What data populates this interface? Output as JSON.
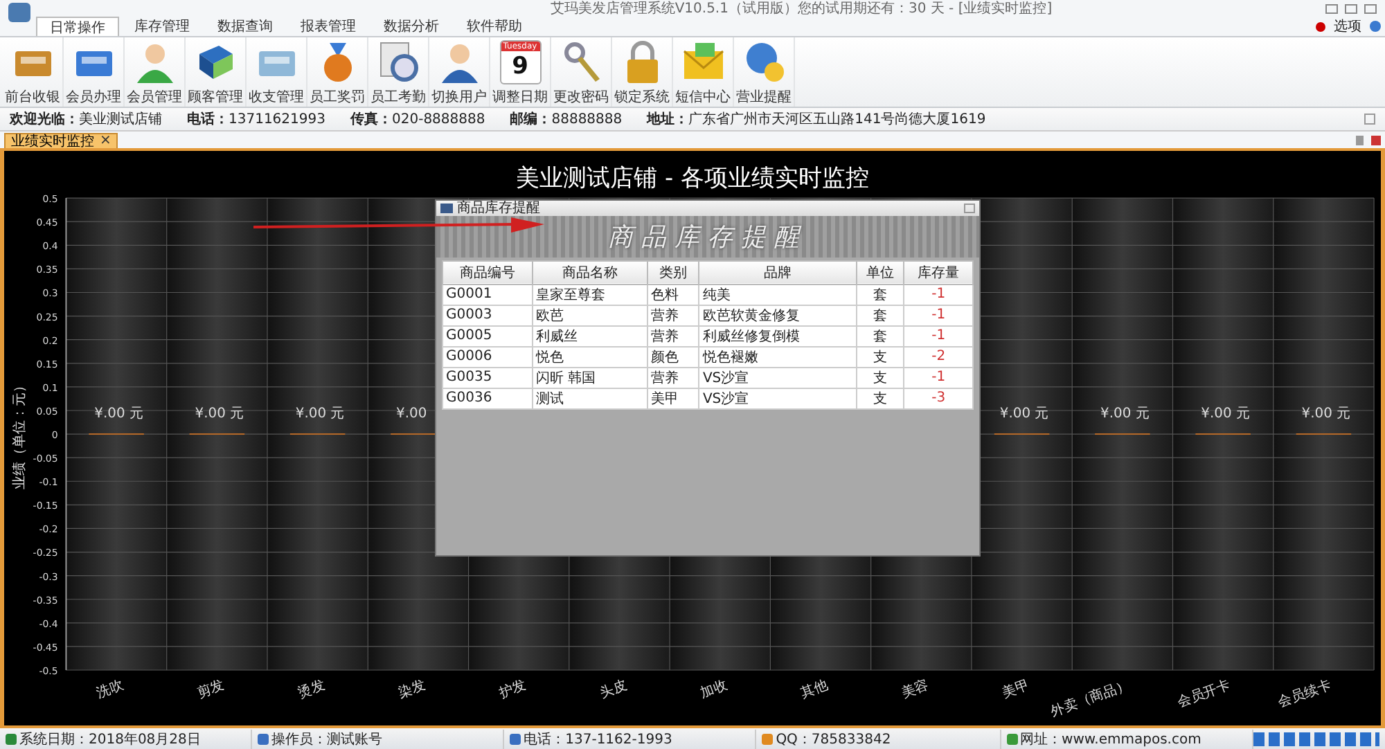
{
  "window": {
    "title": "艾玛美发店管理系统V10.5.1（试用版）您的试用期还有：30 天 - [业绩实时监控]",
    "options": "选项"
  },
  "menu": [
    {
      "label": "日常操作",
      "selected": true
    },
    {
      "label": "库存管理",
      "selected": false
    },
    {
      "label": "数据查询",
      "selected": false
    },
    {
      "label": "报表管理",
      "selected": false
    },
    {
      "label": "数据分析",
      "selected": false
    },
    {
      "label": "软件帮助",
      "selected": false
    }
  ],
  "toolbar": [
    {
      "label": "前台收银"
    },
    {
      "label": "会员办理"
    },
    {
      "label": "会员管理"
    },
    {
      "label": "顾客管理"
    },
    {
      "label": "收支管理"
    },
    {
      "label": "员工奖罚"
    },
    {
      "label": "员工考勤"
    },
    {
      "label": "切换用户"
    },
    {
      "label": "调整日期",
      "day": "Tuesday",
      "date": "9"
    },
    {
      "label": "更改密码"
    },
    {
      "label": "锁定系统"
    },
    {
      "label": "短信中心"
    },
    {
      "label": "营业提醒"
    }
  ],
  "info_bar": [
    {
      "label": "欢迎光临：",
      "value": "美业测试店铺"
    },
    {
      "label": "电话：",
      "value": "13711621993"
    },
    {
      "label": "传真：",
      "value": "020-8888888"
    },
    {
      "label": "邮编：",
      "value": "88888888"
    },
    {
      "label": "地址：",
      "value": "广东省广州市天河区五山路141号尚德大厦1619"
    }
  ],
  "doc_tab": {
    "label": "业绩实时监控",
    "close": "×"
  },
  "chart_data": {
    "type": "bar",
    "title": "美业测试店铺 - 各项业绩实时监控",
    "ylabel": "业绩（单位：元）",
    "categories": [
      "洗吹",
      "剪发",
      "烫发",
      "染发",
      "护发",
      "头皮",
      "加收",
      "其他",
      "美容",
      "美甲",
      "外卖（商品）",
      "会员开卡",
      "会员续卡"
    ],
    "values": [
      0,
      0,
      0,
      0,
      0,
      0,
      0,
      0,
      0,
      0,
      0,
      0,
      0
    ],
    "ylim": [
      -0.5,
      0.5
    ],
    "yticks": [
      {
        "value": -0.5,
        "label": "-0.5"
      },
      {
        "value": -0.45,
        "label": "-0.45"
      },
      {
        "value": -0.4,
        "label": "-0.4"
      },
      {
        "value": -0.35,
        "label": "-0.35"
      },
      {
        "value": -0.3,
        "label": "-0.3"
      },
      {
        "value": -0.25,
        "label": "-0.25"
      },
      {
        "value": -0.2,
        "label": "-0.2"
      },
      {
        "value": -0.15,
        "label": "-0.15"
      },
      {
        "value": -0.1,
        "label": "-0.1"
      },
      {
        "value": -0.05,
        "label": "-0.05"
      },
      {
        "value": 0,
        "label": "0"
      },
      {
        "value": 0.05,
        "label": "0.05"
      },
      {
        "value": 0.1,
        "label": "0.1"
      },
      {
        "value": 0.15,
        "label": "0.15"
      },
      {
        "value": 0.2,
        "label": "0.2"
      },
      {
        "value": 0.25,
        "label": "0.25"
      },
      {
        "value": 0.3,
        "label": "0.3"
      },
      {
        "value": 0.35,
        "label": "0.35"
      },
      {
        "value": 0.4,
        "label": "0.4"
      },
      {
        "value": 0.45,
        "label": "0.45"
      },
      {
        "value": 0.5,
        "label": "0.5"
      }
    ],
    "grid": true,
    "value_labels": [
      "¥.00 元",
      "¥.00 元",
      "¥.00 元",
      "¥.00",
      null,
      null,
      null,
      null,
      null,
      "¥.00 元",
      "¥.00 元",
      "¥.00 元",
      "¥.00 元"
    ]
  },
  "dialog": {
    "title": "商品库存提醒",
    "banner": "商品库存提醒",
    "columns": [
      "商品编号",
      "商品名称",
      "类别",
      "品牌",
      "单位",
      "库存量"
    ],
    "rows": [
      [
        "G0001",
        "皇家至尊套",
        "色料",
        "纯美",
        "套",
        "-1"
      ],
      [
        "G0003",
        "欧芭",
        "营养",
        "欧芭软黄金修复",
        "套",
        "-1"
      ],
      [
        "G0005",
        "利威丝",
        "营养",
        "利威丝修复倒模",
        "套",
        "-1"
      ],
      [
        "G0006",
        "悦色",
        "颜色",
        "悦色褪嫩",
        "支",
        "-2"
      ],
      [
        "G0035",
        "闪昕 韩国",
        "营养",
        "VS沙宣",
        "支",
        "-1"
      ],
      [
        "G0036",
        "测试",
        "美甲",
        "VS沙宣",
        "支",
        "-3"
      ]
    ]
  },
  "status_bar": [
    "系统日期：2018年08月28日",
    "操作员：测试账号",
    "电话：137-1162-1993",
    "QQ：785833842",
    "网址：www.emmapos.com"
  ]
}
